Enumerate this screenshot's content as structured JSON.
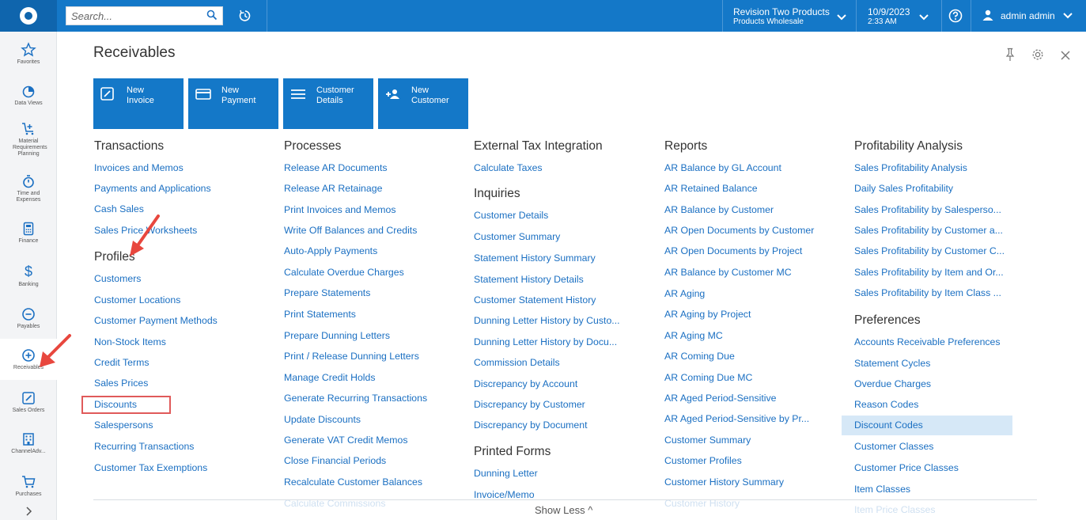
{
  "topbar": {
    "search_placeholder": "Search...",
    "company_line1": "Revision Two Products",
    "company_line2": "Products Wholesale",
    "date": "10/9/2023",
    "time": "2:33 AM",
    "user": "admin admin"
  },
  "nav": {
    "items": [
      {
        "label": "Favorites"
      },
      {
        "label": "Data Views"
      },
      {
        "label": "Material Requirements Planning"
      },
      {
        "label": "Time and Expenses"
      },
      {
        "label": "Finance"
      },
      {
        "label": "Banking"
      },
      {
        "label": "Payables"
      },
      {
        "label": "Receivables"
      },
      {
        "label": "Sales Orders"
      },
      {
        "label": "ChannelAdv..."
      },
      {
        "label": "Purchases"
      }
    ]
  },
  "page": {
    "title": "Receivables",
    "show_less": "Show Less ^"
  },
  "tiles": [
    {
      "line1": "New",
      "line2": "Invoice"
    },
    {
      "line1": "New",
      "line2": "Payment"
    },
    {
      "line1": "Customer",
      "line2": "Details"
    },
    {
      "line1": "New",
      "line2": "Customer"
    }
  ],
  "col1": {
    "transactions_title": "Transactions",
    "transactions": [
      "Invoices and Memos",
      "Payments and Applications",
      "Cash Sales",
      "Sales Price Worksheets"
    ],
    "profiles_title": "Profiles",
    "profiles": [
      "Customers",
      "Customer Locations",
      "Customer Payment Methods",
      "Non-Stock Items",
      "Credit Terms",
      "Sales Prices",
      "Discounts",
      "Salespersons",
      "Recurring Transactions",
      "Customer Tax Exemptions"
    ]
  },
  "col2": {
    "title": "Processes",
    "items": [
      "Release AR Documents",
      "Release AR Retainage",
      "Print Invoices and Memos",
      "Write Off Balances and Credits",
      "Auto-Apply Payments",
      "Calculate Overdue Charges",
      "Prepare Statements",
      "Print Statements",
      "Prepare Dunning Letters",
      "Print / Release Dunning Letters",
      "Manage Credit Holds",
      "Generate Recurring Transactions",
      "Update Discounts",
      "Generate VAT Credit Memos",
      "Close Financial Periods",
      "Recalculate Customer Balances",
      "Calculate Commissions"
    ]
  },
  "col3": {
    "ext_title": "External Tax Integration",
    "ext_items": [
      "Calculate Taxes"
    ],
    "inq_title": "Inquiries",
    "inq_items": [
      "Customer Details",
      "Customer Summary",
      "Statement History Summary",
      "Statement History Details",
      "Customer Statement History",
      "Dunning Letter History by Custo...",
      "Dunning Letter History by Docu...",
      "Commission Details",
      "Discrepancy by Account",
      "Discrepancy by Customer",
      "Discrepancy by Document"
    ],
    "pf_title": "Printed Forms",
    "pf_items": [
      "Dunning Letter",
      "Invoice/Memo"
    ]
  },
  "col4": {
    "title": "Reports",
    "items": [
      "AR Balance by GL Account",
      "AR Retained Balance",
      "AR Balance by Customer",
      "AR Open Documents by Customer",
      "AR Open Documents by Project",
      "AR Balance by Customer MC",
      "AR Aging",
      "AR Aging by Project",
      "AR Aging MC",
      "AR Coming Due",
      "AR Coming Due MC",
      "AR Aged Period-Sensitive",
      "AR Aged Period-Sensitive by Pr...",
      "Customer Summary",
      "Customer Profiles",
      "Customer History Summary",
      "Customer History"
    ]
  },
  "col5": {
    "prof_title": "Profitability Analysis",
    "prof_items": [
      "Sales Profitability Analysis",
      "Daily Sales Profitability",
      "Sales Profitability by Salesperso...",
      "Sales Profitability by Customer a...",
      "Sales Profitability by Customer C...",
      "Sales Profitability by Item and Or...",
      "Sales Profitability by Item Class ..."
    ],
    "pref_title": "Preferences",
    "pref_items": [
      "Accounts Receivable Preferences",
      "Statement Cycles",
      "Overdue Charges",
      "Reason Codes",
      "Discount Codes",
      "Customer Classes",
      "Customer Price Classes",
      "Item Classes",
      "Item Price Classes"
    ]
  }
}
